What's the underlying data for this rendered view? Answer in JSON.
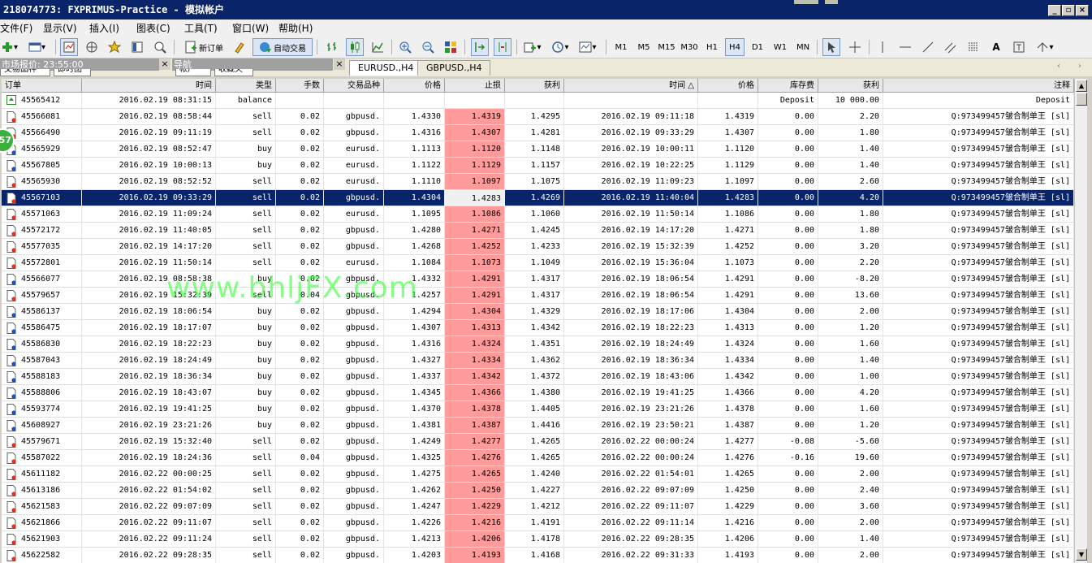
{
  "window": {
    "title": "218074773: FXPRIMUS-Practice - 模拟帐户"
  },
  "menu": [
    "文件(F)",
    "显示(V)",
    "插入(I)",
    "图表(C)",
    "工具(T)",
    "窗口(W)",
    "帮助(H)"
  ],
  "toolbar": {
    "new_order": "新订单",
    "auto_trade": "自动交易",
    "timeframes": [
      "M1",
      "M5",
      "M15",
      "M30",
      "H1",
      "H4",
      "D1",
      "W1",
      "MN"
    ],
    "active_timeframe": "H4"
  },
  "panels": {
    "market_watch": "市场报价: 23:55:00",
    "navigator": "导航",
    "market_tabs": [
      "交易品种",
      "即时图"
    ],
    "nav_tabs": [
      "帐户",
      "收藏夹"
    ]
  },
  "chart_tabs": [
    "EURUSD.,H4",
    "GBPUSD.,H4"
  ],
  "columns": [
    "订单",
    "时间",
    "类型",
    "手数",
    "交易品种",
    "价格",
    "止损",
    "获利",
    "时间",
    "价格",
    "库存费",
    "获利",
    "注释"
  ],
  "rows": [
    {
      "order": "45565412",
      "open_time": "2016.02.19 08:31:15",
      "type": "balance",
      "lots": "",
      "symbol": "",
      "open_price": "",
      "sl": "",
      "tp": "",
      "close_time": "",
      "close_price": "",
      "swap": "Deposit",
      "profit": "10 000.00",
      "comment": "Deposit"
    },
    {
      "order": "45566081",
      "open_time": "2016.02.19 08:58:44",
      "type": "sell",
      "lots": "0.02",
      "symbol": "gbpusd.",
      "open_price": "1.4330",
      "sl": "1.4319",
      "tp": "1.4295",
      "close_time": "2016.02.19 09:11:18",
      "close_price": "1.4319",
      "swap": "0.00",
      "profit": "2.20",
      "comment": "Q:973499457皱合制单王 [sl]"
    },
    {
      "order": "45566490",
      "open_time": "2016.02.19 09:11:19",
      "type": "sell",
      "lots": "0.02",
      "symbol": "gbpusd.",
      "open_price": "1.4316",
      "sl": "1.4307",
      "tp": "1.4281",
      "close_time": "2016.02.19 09:33:29",
      "close_price": "1.4307",
      "swap": "0.00",
      "profit": "1.80",
      "comment": "Q:973499457皱合制单王 [sl]"
    },
    {
      "order": "45565929",
      "open_time": "2016.02.19 08:52:47",
      "type": "buy",
      "lots": "0.02",
      "symbol": "eurusd.",
      "open_price": "1.1113",
      "sl": "1.1120",
      "tp": "1.1148",
      "close_time": "2016.02.19 10:00:11",
      "close_price": "1.1120",
      "swap": "0.00",
      "profit": "1.40",
      "comment": "Q:973499457皱合制单王 [sl]"
    },
    {
      "order": "45567805",
      "open_time": "2016.02.19 10:00:13",
      "type": "buy",
      "lots": "0.02",
      "symbol": "eurusd.",
      "open_price": "1.1122",
      "sl": "1.1129",
      "tp": "1.1157",
      "close_time": "2016.02.19 10:22:25",
      "close_price": "1.1129",
      "swap": "0.00",
      "profit": "1.40",
      "comment": "Q:973499457皱合制单王 [sl]"
    },
    {
      "order": "45565930",
      "open_time": "2016.02.19 08:52:52",
      "type": "sell",
      "lots": "0.02",
      "symbol": "eurusd.",
      "open_price": "1.1110",
      "sl": "1.1097",
      "tp": "1.1075",
      "close_time": "2016.02.19 11:09:23",
      "close_price": "1.1097",
      "swap": "0.00",
      "profit": "2.60",
      "comment": "Q:973499457皱合制单王 [sl]"
    },
    {
      "order": "45567103",
      "open_time": "2016.02.19 09:33:29",
      "type": "sell",
      "lots": "0.02",
      "symbol": "gbpusd.",
      "open_price": "1.4304",
      "sl": "1.4283",
      "tp": "1.4269",
      "close_time": "2016.02.19 11:40:04",
      "close_price": "1.4283",
      "swap": "0.00",
      "profit": "4.20",
      "comment": "Q:973499457皱合制单王 [sl]"
    },
    {
      "order": "45571063",
      "open_time": "2016.02.19 11:09:24",
      "type": "sell",
      "lots": "0.02",
      "symbol": "eurusd.",
      "open_price": "1.1095",
      "sl": "1.1086",
      "tp": "1.1060",
      "close_time": "2016.02.19 11:50:14",
      "close_price": "1.1086",
      "swap": "0.00",
      "profit": "1.80",
      "comment": "Q:973499457皱合制单王 [sl]"
    },
    {
      "order": "45572172",
      "open_time": "2016.02.19 11:40:05",
      "type": "sell",
      "lots": "0.02",
      "symbol": "gbpusd.",
      "open_price": "1.4280",
      "sl": "1.4271",
      "tp": "1.4245",
      "close_time": "2016.02.19 14:17:20",
      "close_price": "1.4271",
      "swap": "0.00",
      "profit": "1.80",
      "comment": "Q:973499457皱合制单王 [sl]"
    },
    {
      "order": "45577035",
      "open_time": "2016.02.19 14:17:20",
      "type": "sell",
      "lots": "0.02",
      "symbol": "gbpusd.",
      "open_price": "1.4268",
      "sl": "1.4252",
      "tp": "1.4233",
      "close_time": "2016.02.19 15:32:39",
      "close_price": "1.4252",
      "swap": "0.00",
      "profit": "3.20",
      "comment": "Q:973499457皱合制单王 [sl]"
    },
    {
      "order": "45572801",
      "open_time": "2016.02.19 11:50:14",
      "type": "sell",
      "lots": "0.02",
      "symbol": "eurusd.",
      "open_price": "1.1084",
      "sl": "1.1073",
      "tp": "1.1049",
      "close_time": "2016.02.19 15:36:04",
      "close_price": "1.1073",
      "swap": "0.00",
      "profit": "2.20",
      "comment": "Q:973499457皱合制单王 [sl]"
    },
    {
      "order": "45566077",
      "open_time": "2016.02.19 08:58:38",
      "type": "buy",
      "lots": "0.02",
      "symbol": "gbpusd.",
      "open_price": "1.4332",
      "sl": "1.4291",
      "tp": "1.4317",
      "close_time": "2016.02.19 18:06:54",
      "close_price": "1.4291",
      "swap": "0.00",
      "profit": "-8.20",
      "comment": "Q:973499457皱合制单王 [sl]"
    },
    {
      "order": "45579657",
      "open_time": "2016.02.19 15:32:39",
      "type": "sell",
      "lots": "0.04",
      "symbol": "gbpusd.",
      "open_price": "1.4257",
      "sl": "1.4291",
      "tp": "1.4317",
      "close_time": "2016.02.19 18:06:54",
      "close_price": "1.4291",
      "swap": "0.00",
      "profit": "13.60",
      "comment": "Q:973499457皱合制单王 [sl]"
    },
    {
      "order": "45586137",
      "open_time": "2016.02.19 18:06:54",
      "type": "buy",
      "lots": "0.02",
      "symbol": "gbpusd.",
      "open_price": "1.4294",
      "sl": "1.4304",
      "tp": "1.4329",
      "close_time": "2016.02.19 18:17:06",
      "close_price": "1.4304",
      "swap": "0.00",
      "profit": "2.00",
      "comment": "Q:973499457皱合制单王 [sl]"
    },
    {
      "order": "45586475",
      "open_time": "2016.02.19 18:17:07",
      "type": "buy",
      "lots": "0.02",
      "symbol": "gbpusd.",
      "open_price": "1.4307",
      "sl": "1.4313",
      "tp": "1.4342",
      "close_time": "2016.02.19 18:22:23",
      "close_price": "1.4313",
      "swap": "0.00",
      "profit": "1.20",
      "comment": "Q:973499457皱合制单王 [sl]"
    },
    {
      "order": "45586830",
      "open_time": "2016.02.19 18:22:23",
      "type": "buy",
      "lots": "0.02",
      "symbol": "gbpusd.",
      "open_price": "1.4316",
      "sl": "1.4324",
      "tp": "1.4351",
      "close_time": "2016.02.19 18:24:49",
      "close_price": "1.4324",
      "swap": "0.00",
      "profit": "1.60",
      "comment": "Q:973499457皱合制单王 [sl]"
    },
    {
      "order": "45587043",
      "open_time": "2016.02.19 18:24:49",
      "type": "buy",
      "lots": "0.02",
      "symbol": "gbpusd.",
      "open_price": "1.4327",
      "sl": "1.4334",
      "tp": "1.4362",
      "close_time": "2016.02.19 18:36:34",
      "close_price": "1.4334",
      "swap": "0.00",
      "profit": "1.40",
      "comment": "Q:973499457皱合制单王 [sl]"
    },
    {
      "order": "45588183",
      "open_time": "2016.02.19 18:36:34",
      "type": "buy",
      "lots": "0.02",
      "symbol": "gbpusd.",
      "open_price": "1.4337",
      "sl": "1.4342",
      "tp": "1.4372",
      "close_time": "2016.02.19 18:43:06",
      "close_price": "1.4342",
      "swap": "0.00",
      "profit": "1.00",
      "comment": "Q:973499457皱合制单王 [sl]"
    },
    {
      "order": "45588806",
      "open_time": "2016.02.19 18:43:07",
      "type": "buy",
      "lots": "0.02",
      "symbol": "gbpusd.",
      "open_price": "1.4345",
      "sl": "1.4366",
      "tp": "1.4380",
      "close_time": "2016.02.19 19:41:25",
      "close_price": "1.4366",
      "swap": "0.00",
      "profit": "4.20",
      "comment": "Q:973499457皱合制单王 [sl]"
    },
    {
      "order": "45593774",
      "open_time": "2016.02.19 19:41:25",
      "type": "buy",
      "lots": "0.02",
      "symbol": "gbpusd.",
      "open_price": "1.4370",
      "sl": "1.4378",
      "tp": "1.4405",
      "close_time": "2016.02.19 23:21:26",
      "close_price": "1.4378",
      "swap": "0.00",
      "profit": "1.60",
      "comment": "Q:973499457皱合制单王 [sl]"
    },
    {
      "order": "45608927",
      "open_time": "2016.02.19 23:21:26",
      "type": "buy",
      "lots": "0.02",
      "symbol": "gbpusd.",
      "open_price": "1.4381",
      "sl": "1.4387",
      "tp": "1.4416",
      "close_time": "2016.02.19 23:50:21",
      "close_price": "1.4387",
      "swap": "0.00",
      "profit": "1.20",
      "comment": "Q:973499457皱合制单王 [sl]"
    },
    {
      "order": "45579671",
      "open_time": "2016.02.19 15:32:40",
      "type": "sell",
      "lots": "0.02",
      "symbol": "gbpusd.",
      "open_price": "1.4249",
      "sl": "1.4277",
      "tp": "1.4265",
      "close_time": "2016.02.22 00:00:24",
      "close_price": "1.4277",
      "swap": "-0.08",
      "profit": "-5.60",
      "comment": "Q:973499457皱合制单王 [sl]"
    },
    {
      "order": "45587022",
      "open_time": "2016.02.19 18:24:36",
      "type": "sell",
      "lots": "0.04",
      "symbol": "gbpusd.",
      "open_price": "1.4325",
      "sl": "1.4276",
      "tp": "1.4265",
      "close_time": "2016.02.22 00:00:24",
      "close_price": "1.4276",
      "swap": "-0.16",
      "profit": "19.60",
      "comment": "Q:973499457皱合制单王 [sl]"
    },
    {
      "order": "45611182",
      "open_time": "2016.02.22 00:00:25",
      "type": "sell",
      "lots": "0.02",
      "symbol": "gbpusd.",
      "open_price": "1.4275",
      "sl": "1.4265",
      "tp": "1.4240",
      "close_time": "2016.02.22 01:54:01",
      "close_price": "1.4265",
      "swap": "0.00",
      "profit": "2.00",
      "comment": "Q:973499457皱合制单王 [sl]"
    },
    {
      "order": "45613186",
      "open_time": "2016.02.22 01:54:02",
      "type": "sell",
      "lots": "0.02",
      "symbol": "gbpusd.",
      "open_price": "1.4262",
      "sl": "1.4250",
      "tp": "1.4227",
      "close_time": "2016.02.22 09:07:09",
      "close_price": "1.4250",
      "swap": "0.00",
      "profit": "2.40",
      "comment": "Q:973499457皱合制单王 [sl]"
    },
    {
      "order": "45621583",
      "open_time": "2016.02.22 09:07:09",
      "type": "sell",
      "lots": "0.02",
      "symbol": "gbpusd.",
      "open_price": "1.4247",
      "sl": "1.4229",
      "tp": "1.4212",
      "close_time": "2016.02.22 09:11:07",
      "close_price": "1.4229",
      "swap": "0.00",
      "profit": "3.60",
      "comment": "Q:973499457皱合制单王 [sl]"
    },
    {
      "order": "45621866",
      "open_time": "2016.02.22 09:11:07",
      "type": "sell",
      "lots": "0.02",
      "symbol": "gbpusd.",
      "open_price": "1.4226",
      "sl": "1.4216",
      "tp": "1.4191",
      "close_time": "2016.02.22 09:11:14",
      "close_price": "1.4216",
      "swap": "0.00",
      "profit": "2.00",
      "comment": "Q:973499457皱合制单王 [sl]"
    },
    {
      "order": "45621903",
      "open_time": "2016.02.22 09:11:24",
      "type": "sell",
      "lots": "0.02",
      "symbol": "gbpusd.",
      "open_price": "1.4213",
      "sl": "1.4206",
      "tp": "1.4178",
      "close_time": "2016.02.22 09:28:35",
      "close_price": "1.4206",
      "swap": "0.00",
      "profit": "1.40",
      "comment": "Q:973499457皱合制单王 [sl]"
    },
    {
      "order": "45622582",
      "open_time": "2016.02.22 09:28:35",
      "type": "sell",
      "lots": "0.02",
      "symbol": "gbpusd.",
      "open_price": "1.4203",
      "sl": "1.4193",
      "tp": "1.4168",
      "close_time": "2016.02.22 09:31:33",
      "close_price": "1.4193",
      "swap": "0.00",
      "profit": "2.00",
      "comment": "Q:973499457皱合制单王 [sl]"
    }
  ],
  "selected_order": "45567103",
  "watermark": "www.bhljFX.com",
  "badge": "57",
  "colors": {
    "titlebar": "#0a246a",
    "selection": "#0a246a",
    "stoploss_cell": "#ff9b9b",
    "watermark": "#33ff33"
  }
}
